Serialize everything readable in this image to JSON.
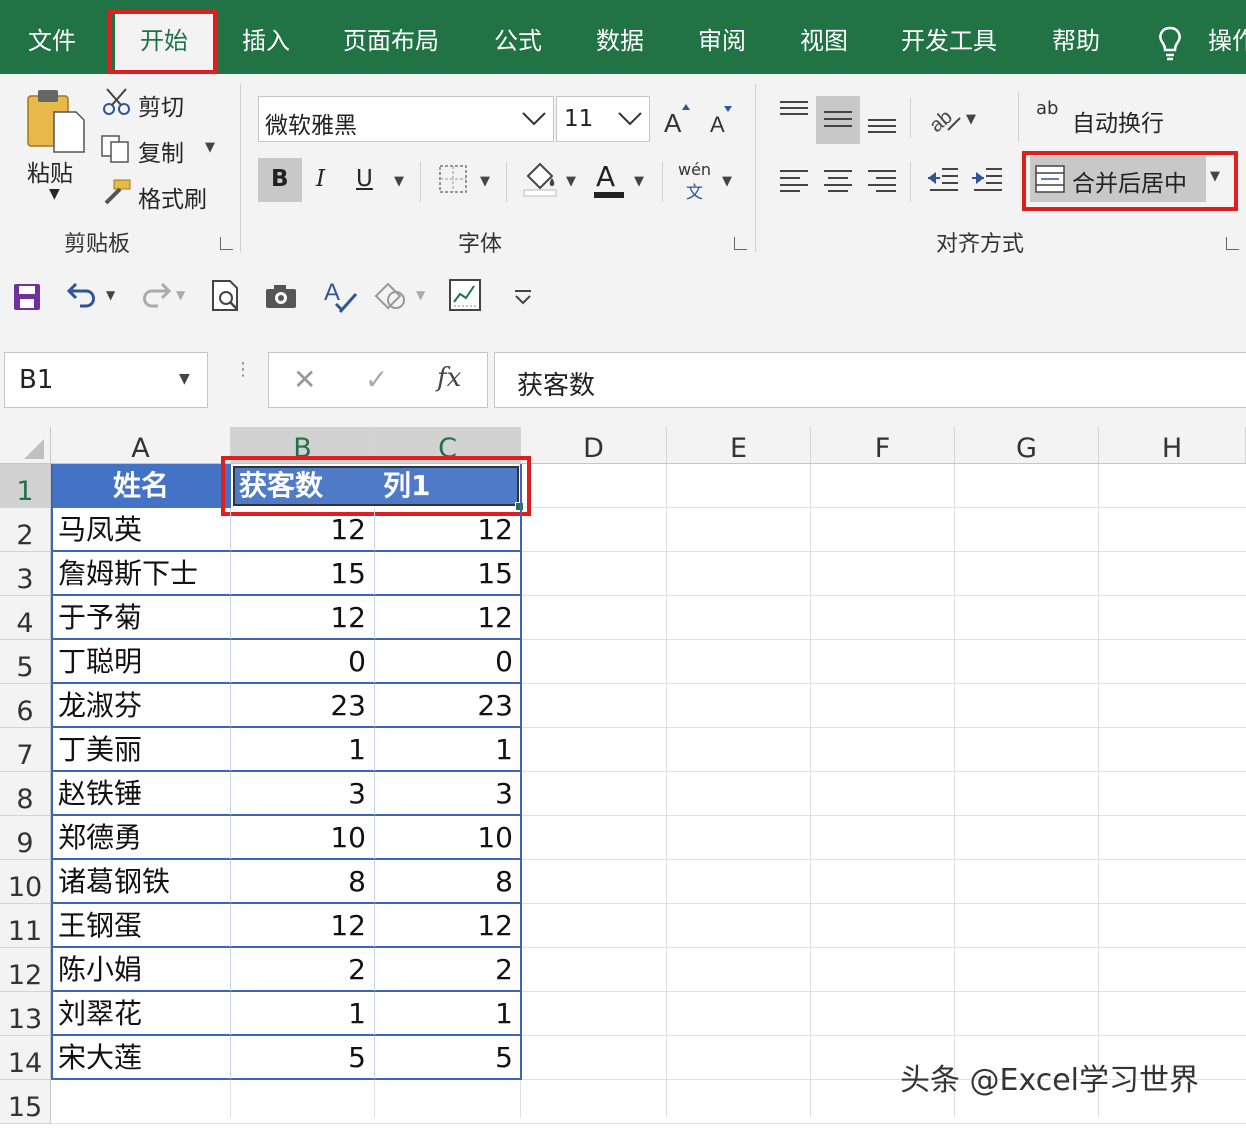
{
  "ribbon_tabs": [
    "文件",
    "开始",
    "插入",
    "页面布局",
    "公式",
    "数据",
    "审阅",
    "视图",
    "开发工具",
    "帮助",
    "操作"
  ],
  "active_tab": "开始",
  "clipboard": {
    "paste": "粘贴",
    "cut": "剪切",
    "copy": "复制",
    "format_painter": "格式刷",
    "group": "剪贴板"
  },
  "font": {
    "name": "微软雅黑",
    "size": "11",
    "bold": "B",
    "italic": "I",
    "underline": "U",
    "font_color": "A",
    "phonetic_top": "wén",
    "phonetic_bottom": "文",
    "group": "字体"
  },
  "alignment": {
    "wrap_text": "自动换行",
    "wrap_icon": "ab",
    "merge_center": "合并后居中",
    "group": "对齐方式"
  },
  "formula_bar": {
    "name_box": "B1",
    "fx": "fx",
    "content": "获客数"
  },
  "columns": [
    "A",
    "B",
    "C",
    "D",
    "E",
    "F",
    "G",
    "H"
  ],
  "rows": [
    "1",
    "2",
    "3",
    "4",
    "5",
    "6",
    "7",
    "8",
    "9",
    "10",
    "11",
    "12",
    "13",
    "14",
    "15"
  ],
  "table": {
    "headers": [
      "姓名",
      "获客数",
      "列1"
    ],
    "records": [
      {
        "name": "马凤英",
        "b": "12",
        "c": "12"
      },
      {
        "name": "詹姆斯下士",
        "b": "15",
        "c": "15"
      },
      {
        "name": "于予菊",
        "b": "12",
        "c": "12"
      },
      {
        "name": "丁聪明",
        "b": "0",
        "c": "0"
      },
      {
        "name": "龙淑芬",
        "b": "23",
        "c": "23"
      },
      {
        "name": "丁美丽",
        "b": "1",
        "c": "1"
      },
      {
        "name": "赵铁锤",
        "b": "3",
        "c": "3"
      },
      {
        "name": "郑德勇",
        "b": "10",
        "c": "10"
      },
      {
        "name": "诸葛钢铁",
        "b": "8",
        "c": "8"
      },
      {
        "name": "王钢蛋",
        "b": "12",
        "c": "12"
      },
      {
        "name": "陈小娟",
        "b": "2",
        "c": "2"
      },
      {
        "name": "刘翠花",
        "b": "1",
        "c": "1"
      },
      {
        "name": "宋大莲",
        "b": "5",
        "c": "5"
      }
    ]
  },
  "watermark": "头条 @Excel学习世界",
  "colors": {
    "excel_green": "#217346",
    "table_header": "#4472c4",
    "highlight": "#e01e1e"
  }
}
